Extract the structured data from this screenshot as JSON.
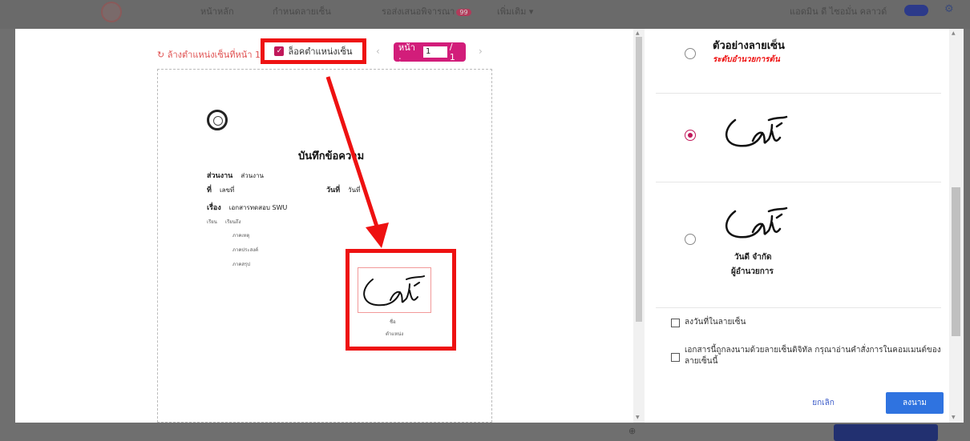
{
  "background_app": {
    "nav": [
      "หน้าหลัก",
      "กำหนดลายเซ็น",
      "รอส่งเสนอพิจารณา",
      "เพิ่มเติม ▾"
    ],
    "badge": "99",
    "user": "แอดมิน ดี ไซอมั่น คลาวด์"
  },
  "toolbar": {
    "reset_label": "ล้างตำแหน่งเซ็นที่หน้า 1",
    "lock_label": "ล็อคตำแหน่งเซ็น",
    "page_label": "หน้า :",
    "page_value": "1",
    "page_total": "/ 1"
  },
  "document": {
    "title": "บันทึกข้อความ",
    "dept_label": "ส่วนงาน",
    "dept_value": "ส่วนงาน",
    "no_label": "ที่",
    "no_value": "เลขที่",
    "date_label": "วันที่",
    "date_value": "วันที่",
    "subject_label": "เรื่อง",
    "subject_value": "เอกสารทดสอบ SWU",
    "to_label": "เรียน",
    "to_value": "เรียนถึง",
    "reason": "ภาคเหตุ",
    "purpose": "ภาคประสงค์",
    "summary": "ภาคสรุป",
    "sig_name": "ชื่อ",
    "sig_position": "ตำแหน่ง"
  },
  "signature_panel": {
    "sample_title": "ตัวอย่างลายเซ็น",
    "sample_subtitle": "ระดับอำนวยการต้น",
    "option3_company": "วันดี จำกัด",
    "option3_role": "ผู้อำนวยการ",
    "date_checkbox_label": "ลงวันที่ในลายเซ็น",
    "digital_checkbox_label": "เอกสารนี้ถูกลงนามด้วยลายเซ็นดิจิทัล กรุณาอ่านคำสั่งการในคอมเมนต์ของลายเซ็นนี้",
    "cancel_label": "ยกเลิก",
    "sign_label": "ลงนาม"
  },
  "colors": {
    "accent": "#d21d7a",
    "annotation": "#ee1111",
    "primary_button": "#2f73e0"
  }
}
